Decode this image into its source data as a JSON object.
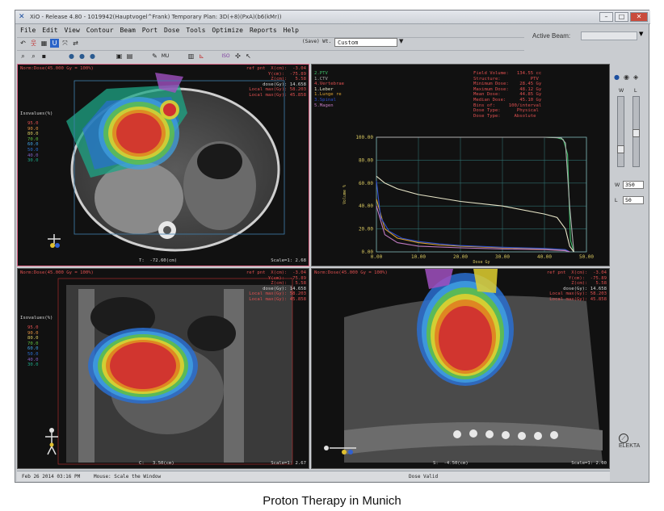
{
  "window": {
    "title": "XiO - Release 4.80 - 1019942(Hauptvogel^Frank) Temporary Plan: 3D(+8)(PxA)(b6(kMr))",
    "buttons": [
      "–",
      "□",
      "✕"
    ]
  },
  "menu": [
    "File",
    "Edit",
    "View",
    "Contour",
    "Beam",
    "Port",
    "Dose",
    "Tools",
    "Optimize",
    "Reports",
    "Help"
  ],
  "toolbar": {
    "save_wt_label": "(Save) Wt.",
    "dose_option": "Custom",
    "icons": [
      "undo-icon",
      "person-icon",
      "grid-icon",
      "highlight-icon",
      "link-icon",
      "compare-icon",
      "zoom-in-icon",
      "zoom-out-icon",
      "save-icon",
      "globe1-icon",
      "globe2-icon",
      "globe3-icon",
      "map1-icon",
      "map2-icon",
      "tool1-icon",
      "mu-icon",
      "table-icon",
      "chart-icon",
      "iso-icon",
      "settings-icon",
      "pointer-icon"
    ]
  },
  "active_beam": {
    "label": "Active Beam:",
    "value": ""
  },
  "axial": {
    "header_left": "Norm:Dose(45.000 Gy = 100%)",
    "ref_lines": [
      "ref pnt  X(cm):  -3.04",
      "Y(cm):  -75.89",
      "Z(cm):   5.58",
      "dose(Gy): 14.658",
      "Local max(Gy): 58.203",
      "Local max(Gy): 45.858"
    ],
    "isovalues_label": "Isovalues(%)",
    "isovalues": [
      "95.0",
      "90.0",
      "80.0",
      "70.0",
      "60.0",
      "50.0",
      "40.0",
      "30.0"
    ],
    "footer_center": "T:  -72.60(cm)",
    "footer_right": "Scale=1: 2.68"
  },
  "dvh": {
    "legend_left": [
      "2.PTV",
      "1.CTV",
      "4.Vertebrae",
      "",
      "1.Leber",
      "1.Lunge re",
      "3.Spinal",
      "5.Magen"
    ],
    "stats_lines": [
      "Field Volume:   134.55 cc",
      "Structure:           PTV",
      "Minimum Dose:    28.45 Gy",
      "Maximum Dose:    48.12 Gy",
      "Mean Dose:       44.85 Gy",
      "Median Dose:     45.10 Gy",
      "Bins of:     100/interval",
      "Dose Type:      Physical",
      "Dose Type:     Absolute"
    ],
    "y_axis_title": "Volume %",
    "x_axis_title": "Dose Gy"
  },
  "chart_data": {
    "type": "line",
    "xlabel": "Dose Gy",
    "ylabel": "Volume %",
    "xlim": [
      0,
      50
    ],
    "ylim": [
      0,
      100
    ],
    "x_ticks": [
      "0.00",
      "10.00",
      "20.00",
      "30.00",
      "40.00",
      "50.00"
    ],
    "y_ticks": [
      "0.00",
      "20.00",
      "40.00",
      "60.00",
      "80.00",
      "100.00"
    ],
    "grid": true,
    "series": [
      {
        "name": "2.PTV",
        "color": "#3fbf6a",
        "x": [
          0,
          30,
          40,
          43,
          44.5,
          45.5,
          46.2,
          47
        ],
        "y": [
          100,
          100,
          100,
          99.5,
          98,
          85,
          10,
          0
        ]
      },
      {
        "name": "1.CTV",
        "color": "#b0b0b0",
        "x": [
          0,
          30,
          40,
          44,
          45,
          46,
          47
        ],
        "y": [
          100,
          100,
          100,
          99.5,
          95,
          40,
          0
        ]
      },
      {
        "name": "1.Leber",
        "color": "#e8e6c8",
        "x": [
          0,
          2,
          5,
          10,
          20,
          30,
          40,
          43,
          45,
          46,
          47
        ],
        "y": [
          66,
          60,
          55,
          50,
          44,
          40,
          33,
          30,
          20,
          5,
          0
        ]
      },
      {
        "name": "1.Lunge re",
        "color": "#d9a030",
        "x": [
          0,
          2,
          5,
          10,
          15,
          20,
          30,
          40,
          45,
          46
        ],
        "y": [
          46,
          20,
          12,
          8,
          6,
          5,
          3.5,
          2.5,
          1.5,
          0
        ]
      },
      {
        "name": "3.Spinal",
        "color": "#3050d0",
        "x": [
          0,
          1,
          3,
          6,
          10,
          15,
          20,
          30,
          40,
          45,
          46
        ],
        "y": [
          62,
          30,
          18,
          12,
          9,
          7,
          5.5,
          4,
          3,
          2,
          0
        ]
      },
      {
        "name": "5.Magen",
        "color": "#c07ac0",
        "x": [
          0,
          2,
          5,
          10,
          20,
          30,
          40,
          45,
          46
        ],
        "y": [
          40,
          15,
          8,
          5,
          3.5,
          2.5,
          2,
          1,
          0
        ]
      }
    ]
  },
  "coronal": {
    "header_left": "Norm:Dose(45.000 Gy = 100%)",
    "ref_lines": [
      "ref pnt  X(cm):  -3.04",
      "Y(cm):  -75.89",
      "Z(cm):   5.58",
      "dose(Gy): 14.658",
      "Local max(Gy): 58.203",
      "Local max(Gy): 45.858"
    ],
    "isovalues_label": "Isovalues(%)",
    "isovalues": [
      "95.0",
      "90.0",
      "80.0",
      "70.0",
      "60.0",
      "50.0",
      "40.0",
      "30.0"
    ],
    "footer_center": "C:   3.50(cm)",
    "footer_right": "Scale=1: 2.67"
  },
  "sagittal": {
    "header_left": "Norm:Dose(45.000 Gy = 100%)",
    "ref_lines": [
      "ref pnt  X(cm):  -3.04",
      "Y(cm):  -75.89",
      "Z(cm):   5.58",
      "dose(Gy): 14.658",
      "Local max(Gy): 58.203",
      "Local max(Gy): 45.858"
    ],
    "footer_center": "S:  -4.50(cm)",
    "footer_right": "Scale=1: 2.00"
  },
  "side_panel": {
    "w_label": "W",
    "l_label": "L",
    "w_value": "350",
    "l_value": "50",
    "logo": "ELEKTA"
  },
  "status": {
    "datetime": "Feb 26 2014 03:16 PM",
    "mouse": "Mouse:   Scale the Window",
    "dose_state": "Dose Valid"
  },
  "caption": "Proton Therapy in Munich"
}
